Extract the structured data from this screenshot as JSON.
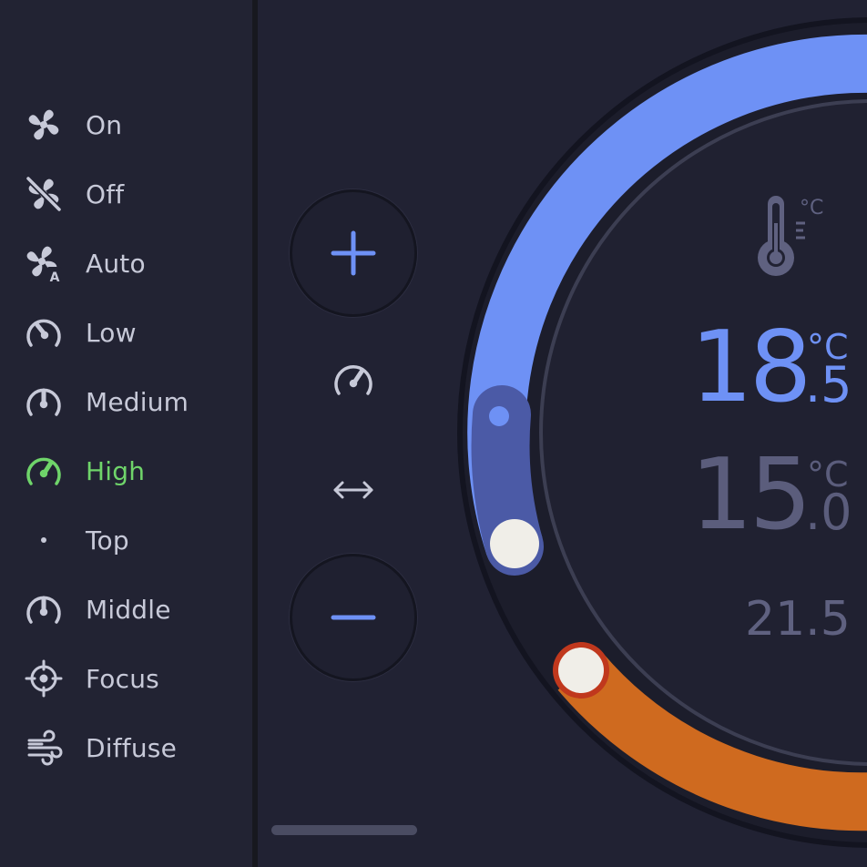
{
  "sidebar": {
    "items": [
      {
        "label": "On",
        "icon": "fan-icon",
        "active": false
      },
      {
        "label": "Off",
        "icon": "fan-off-icon",
        "active": false
      },
      {
        "label": "Auto",
        "icon": "fan-auto-icon",
        "active": false
      },
      {
        "label": "Low",
        "icon": "speed-low-icon",
        "active": false
      },
      {
        "label": "Medium",
        "icon": "speed-medium-icon",
        "active": false
      },
      {
        "label": "High",
        "icon": "speed-high-icon",
        "active": true
      },
      {
        "label": "Top",
        "icon": "dot-icon",
        "active": false
      },
      {
        "label": "Middle",
        "icon": "swing-middle-icon",
        "active": false
      },
      {
        "label": "Focus",
        "icon": "crosshair-icon",
        "active": false
      },
      {
        "label": "Diffuse",
        "icon": "wind-icon",
        "active": false
      }
    ]
  },
  "controls": {
    "increase": {
      "icon": "plus-icon"
    },
    "decrease": {
      "icon": "minus-icon"
    },
    "fan_mode_icon": "speed-high-icon",
    "swing_mode_icon": "swing-horizontal-icon"
  },
  "thermostat": {
    "target": {
      "integer": "18",
      "decimal": ".5",
      "unit": "°C"
    },
    "current": {
      "integer": "15",
      "decimal": ".0",
      "unit": "°C"
    },
    "outdoor": "21.5",
    "temperature_icon": "thermometer-celsius-icon"
  },
  "colors": {
    "background": "#212233",
    "cool": "#6e91f5",
    "heat": "#cf6a1f",
    "active": "#6fd46a",
    "text": "#c7c9d8"
  }
}
